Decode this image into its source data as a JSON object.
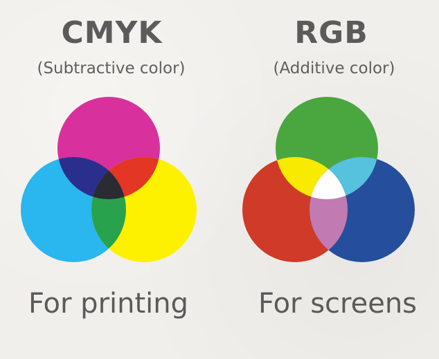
{
  "cmyk": {
    "title": "CMYK",
    "subtitle": "(Subtractive color)",
    "caption": "For printing",
    "colors": {
      "magenta": "#d8319d",
      "cyan": "#2ab6ee",
      "yellow": "#fdf100",
      "magenta_cyan": "#2a2f8d",
      "magenta_yellow": "#e43624",
      "cyan_yellow": "#28a24c",
      "center": "#2b2b34"
    }
  },
  "rgb": {
    "title": "RGB",
    "subtitle": "(Additive color)",
    "caption": "For screens",
    "colors": {
      "green": "#4aa63f",
      "red": "#cf3b28",
      "blue": "#254f9c",
      "red_green": "#f8ea00",
      "green_blue": "#56c2de",
      "red_blue": "#c27ab3",
      "center": "#ffffff"
    }
  }
}
